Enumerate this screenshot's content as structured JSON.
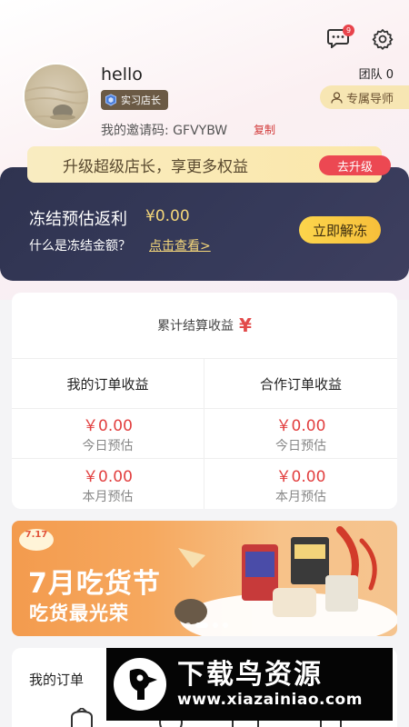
{
  "header": {
    "message_badge": "9",
    "icons": [
      "message-icon",
      "settings-icon"
    ]
  },
  "profile": {
    "username": "hello",
    "level": "实习店长",
    "invite_label": "我的邀请码: GFVYBW",
    "copy_label": "复制",
    "team_label": "团队  0",
    "mentor_label": "专属导师"
  },
  "upgrade": {
    "text": "升级超级店长，享更多权益",
    "button": "去升级"
  },
  "frozen": {
    "title": "冻结预估返利",
    "amount": "¥0.00",
    "question": "什么是冻结金额？",
    "link": "点击查看>",
    "button": "立即解冻"
  },
  "earnings": {
    "title": "累计结算收益",
    "columns": [
      "我的订单收益",
      "合作订单收益"
    ],
    "rows": [
      {
        "values": [
          "￥0.00",
          "￥0.00"
        ],
        "label": "今日预估"
      },
      {
        "values": [
          "￥0.00",
          "￥0.00"
        ],
        "label": "本月预估"
      }
    ]
  },
  "promo": {
    "tag": "7.17",
    "title": "7月吃货节",
    "subtitle": "吃货最光荣",
    "slides": 4,
    "active_slide": 1
  },
  "orders": {
    "title": "我的订单"
  },
  "watermark": {
    "title": "下载鸟资源",
    "url": "www.xiazainiao.com"
  },
  "colors": {
    "accent_red": "#e24040",
    "dark_card": "#32365a",
    "gold": "#f5d77a"
  }
}
